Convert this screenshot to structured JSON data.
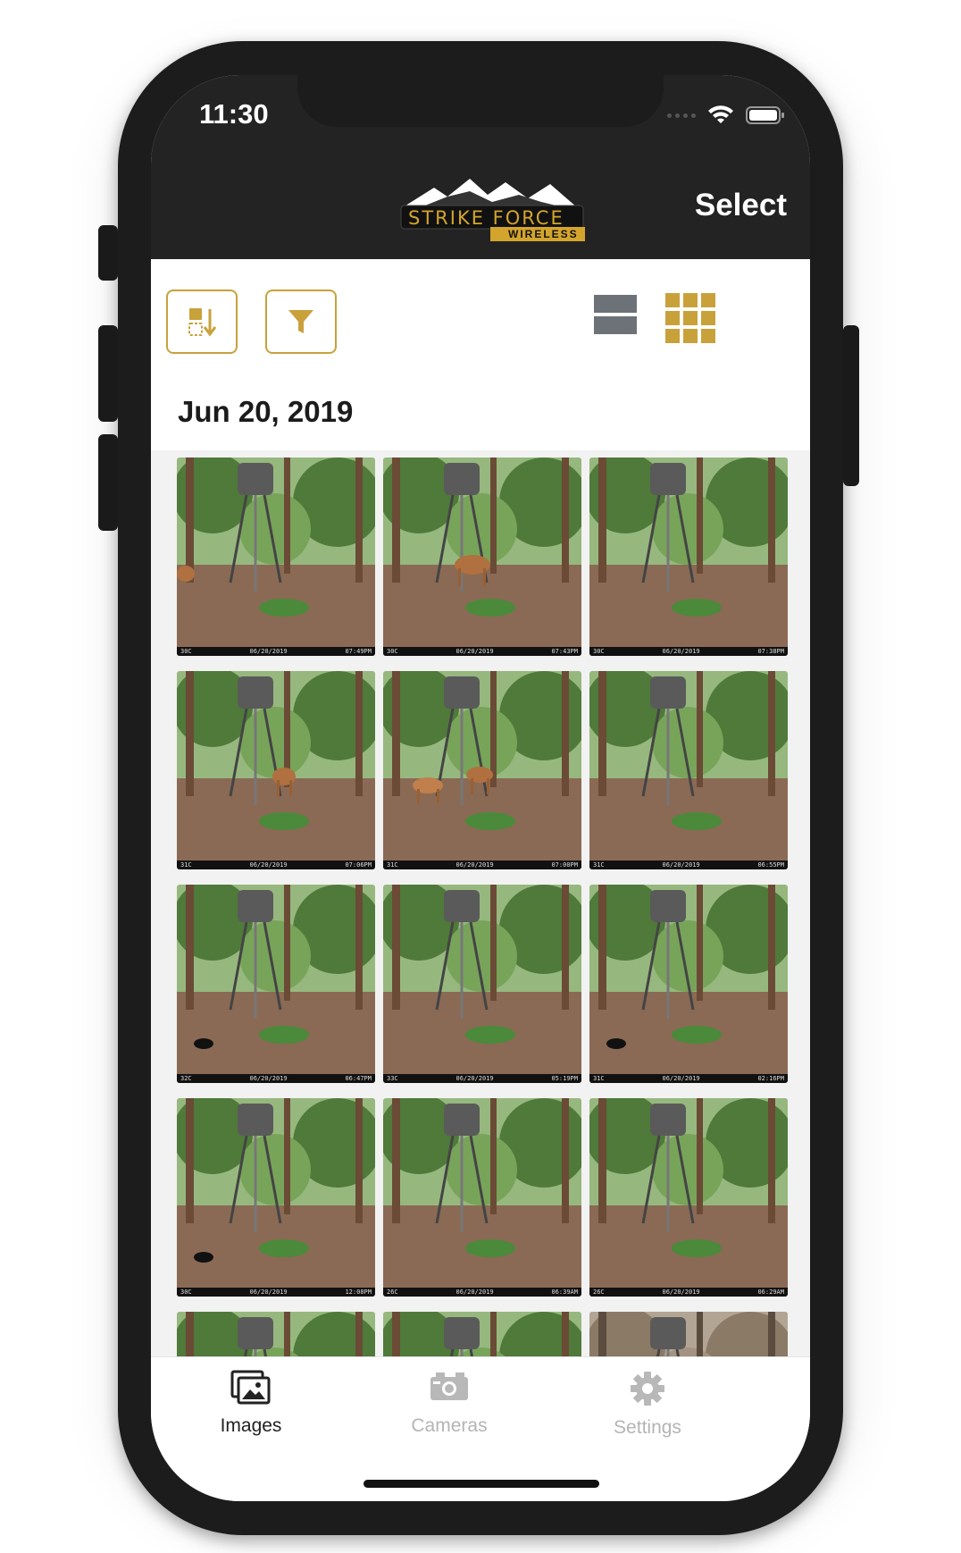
{
  "status_bar": {
    "time": "11:30"
  },
  "header": {
    "logo_main": "STRIKE FORCE",
    "logo_sub": "WIRELESS",
    "select_label": "Select"
  },
  "toolbar": {
    "sort_icon": "sort-icon",
    "filter_icon": "filter-icon",
    "list_view_icon": "list-view-icon",
    "grid_view_icon": "grid-view-icon",
    "accent_color": "#c9a13b",
    "inactive_color": "#6d7278"
  },
  "gallery": {
    "date": "Jun 20, 2019",
    "photos": [
      {
        "temp": "30C",
        "date": "06/20/2019",
        "time": "07:49PM",
        "deer": "left"
      },
      {
        "temp": "30C",
        "date": "06/20/2019",
        "time": "07:43PM",
        "deer": "center"
      },
      {
        "temp": "30C",
        "date": "06/20/2019",
        "time": "07:38PM",
        "deer": "none"
      },
      {
        "temp": "31C",
        "date": "06/20/2019",
        "time": "07:06PM",
        "deer": "right"
      },
      {
        "temp": "31C",
        "date": "06/20/2019",
        "time": "07:00PM",
        "deer": "two"
      },
      {
        "temp": "31C",
        "date": "06/20/2019",
        "time": "06:55PM",
        "deer": "none"
      },
      {
        "temp": "32C",
        "date": "06/20/2019",
        "time": "06:47PM",
        "deer": "bird"
      },
      {
        "temp": "33C",
        "date": "06/20/2019",
        "time": "05:19PM",
        "deer": "none"
      },
      {
        "temp": "31C",
        "date": "06/20/2019",
        "time": "02:16PM",
        "deer": "bird"
      },
      {
        "temp": "30C",
        "date": "06/20/2019",
        "time": "12:08PM",
        "deer": "bird"
      },
      {
        "temp": "26C",
        "date": "06/20/2019",
        "time": "06:39AM",
        "deer": "none"
      },
      {
        "temp": "26C",
        "date": "06/20/2019",
        "time": "06:29AM",
        "deer": "none"
      },
      {
        "temp": "",
        "date": "",
        "time": "",
        "deer": "none"
      },
      {
        "temp": "",
        "date": "",
        "time": "",
        "deer": "none"
      },
      {
        "temp": "",
        "date": "",
        "time": "",
        "deer": "sepia"
      }
    ]
  },
  "tabs": [
    {
      "label": "Images",
      "icon": "images-icon",
      "active": true
    },
    {
      "label": "Cameras",
      "icon": "camera-icon",
      "active": false
    },
    {
      "label": "Settings",
      "icon": "gear-icon",
      "active": false
    }
  ]
}
